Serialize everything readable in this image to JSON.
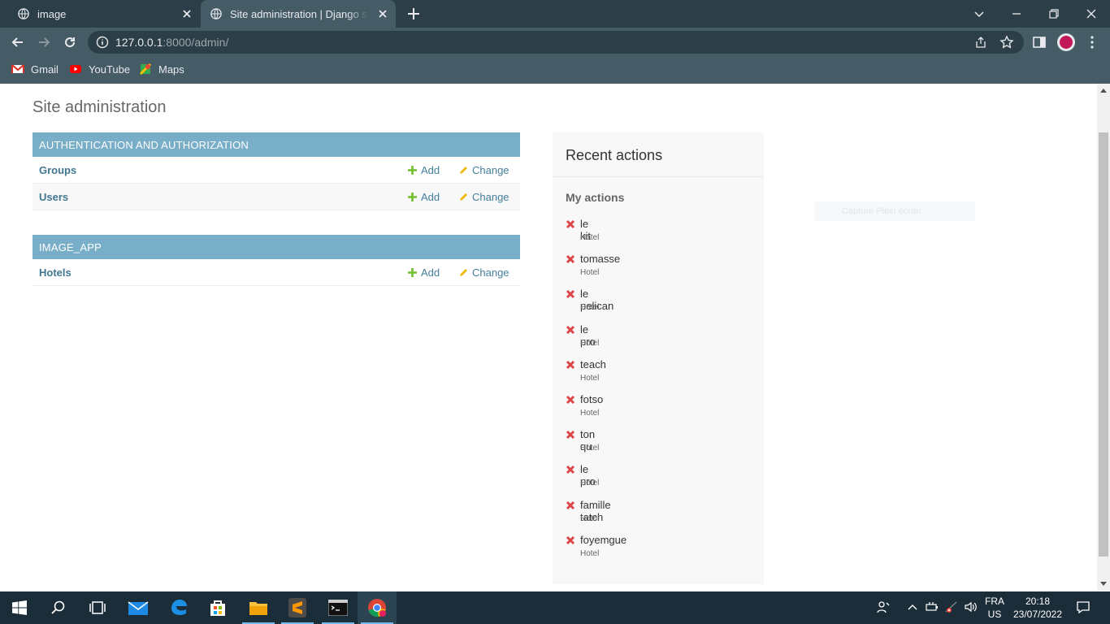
{
  "browser": {
    "tabs": [
      {
        "title": "image"
      },
      {
        "title": "Site administration | Django site admin"
      }
    ],
    "url_host": "127.0.0.1",
    "url_rest": ":8000/admin/",
    "bookmarks": [
      {
        "label": "Gmail",
        "icon": "gmail-icon"
      },
      {
        "label": "YouTube",
        "icon": "youtube-icon"
      },
      {
        "label": "Maps",
        "icon": "maps-icon"
      }
    ]
  },
  "page": {
    "title": "Site administration",
    "modules": [
      {
        "caption": "AUTHENTICATION AND AUTHORIZATION",
        "rows": [
          {
            "name": "Groups",
            "add": "Add",
            "change": "Change"
          },
          {
            "name": "Users",
            "add": "Add",
            "change": "Change"
          }
        ]
      },
      {
        "caption": "IMAGE_APP",
        "rows": [
          {
            "name": "Hotels",
            "add": "Add",
            "change": "Change"
          }
        ]
      }
    ],
    "recent": {
      "title": "Recent actions",
      "subtitle": "My actions",
      "items": [
        {
          "name": "le kit",
          "type": "Hotel"
        },
        {
          "name": "tomasse",
          "type": "Hotel"
        },
        {
          "name": "le pelican",
          "type": "Hotel"
        },
        {
          "name": "le pro",
          "type": "Hotel"
        },
        {
          "name": "teach",
          "type": "Hotel"
        },
        {
          "name": "fotso",
          "type": "Hotel"
        },
        {
          "name": "ton qu",
          "type": "Hotel"
        },
        {
          "name": "le pro",
          "type": "Hotel"
        },
        {
          "name": "famille tatch",
          "type": "Hotel"
        },
        {
          "name": "foyemgue",
          "type": "Hotel"
        }
      ]
    },
    "ghost_text": "Capture Plein écran"
  },
  "taskbar": {
    "lang_top": "FRA",
    "lang_bottom": "US",
    "time": "20:18",
    "date": "23/07/2022"
  },
  "colors": {
    "module_caption_bg": "#79aec8",
    "link": "#447e9b",
    "model_name": "#417690",
    "delete": "#dd4646",
    "add": "#70bf2b",
    "change": "#efb80b"
  }
}
